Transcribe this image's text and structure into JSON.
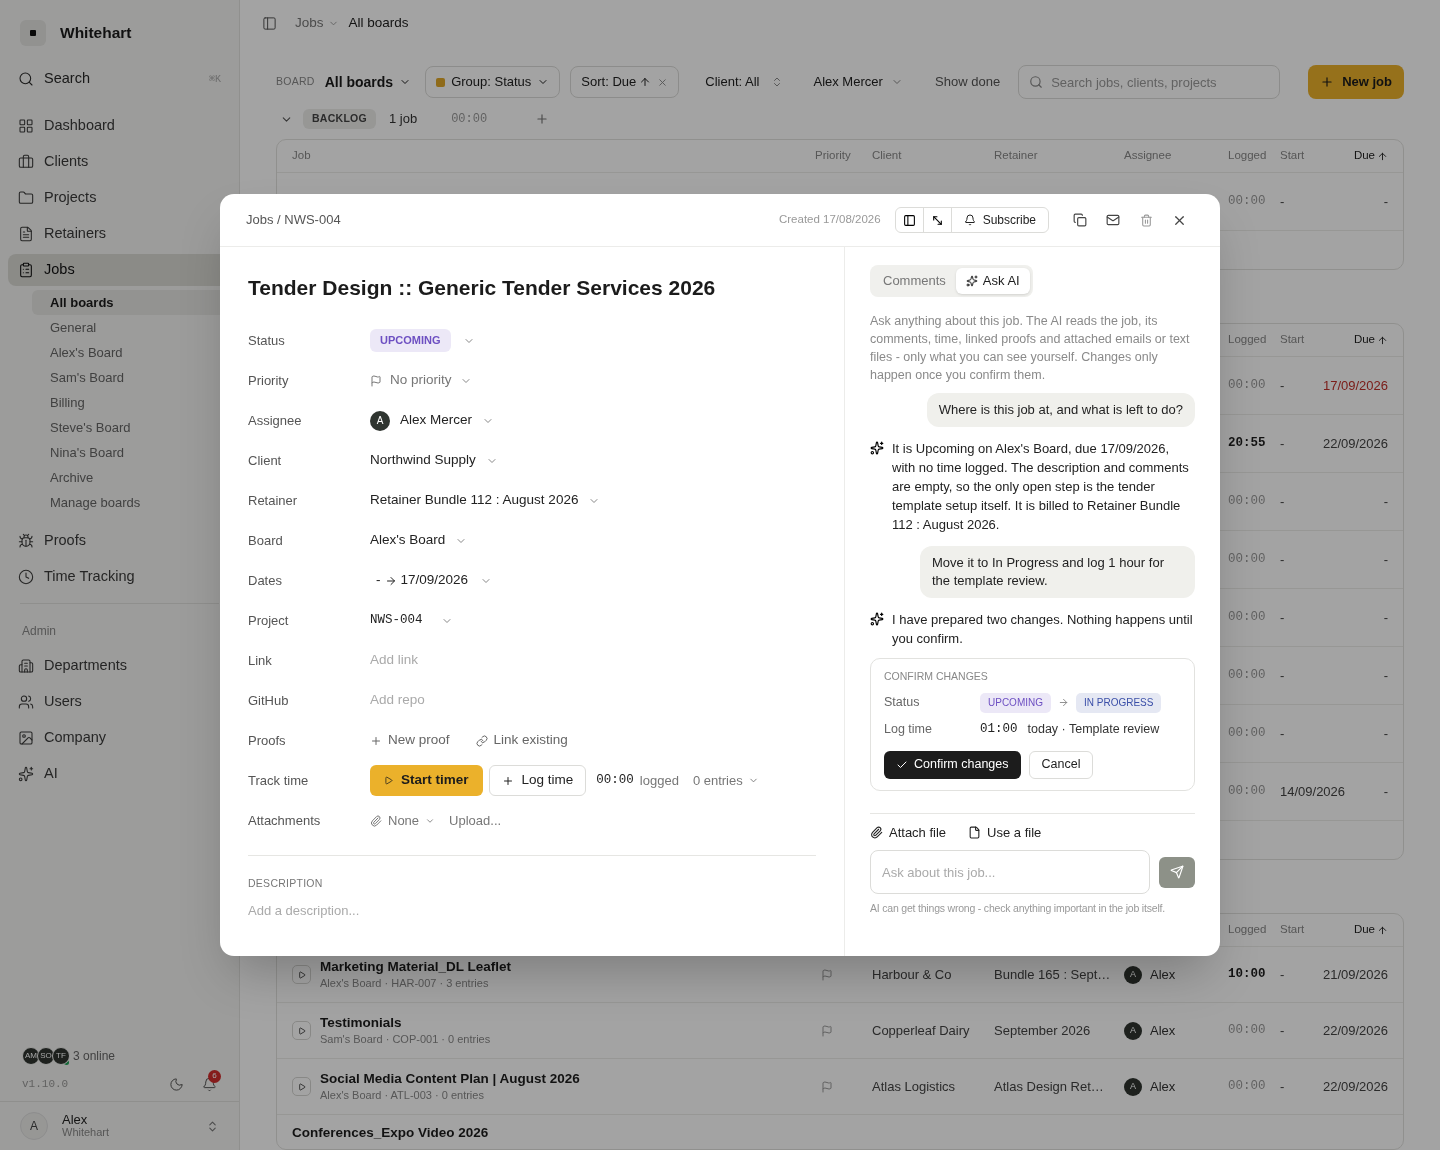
{
  "sidebar": {
    "brand": "Whitehart",
    "search": {
      "label": "Search",
      "shortcut": "⌘K"
    },
    "nav": [
      {
        "label": "Dashboard",
        "selected": false
      },
      {
        "label": "Clients",
        "selected": false
      },
      {
        "label": "Projects",
        "selected": false
      },
      {
        "label": "Retainers",
        "selected": false
      },
      {
        "label": "Jobs",
        "selected": true,
        "children": [
          {
            "label": "All boards",
            "selected": true
          },
          {
            "label": "General",
            "selected": false
          },
          {
            "label": "Alex's Board",
            "selected": false
          },
          {
            "label": "Sam's Board",
            "selected": false
          },
          {
            "label": "Billing",
            "selected": false
          },
          {
            "label": "Steve's Board",
            "selected": false
          },
          {
            "label": "Nina's Board",
            "selected": false
          },
          {
            "label": "Archive",
            "selected": false
          },
          {
            "label": "Manage boards",
            "selected": false
          }
        ]
      },
      {
        "label": "Proofs",
        "selected": false
      },
      {
        "label": "Time Tracking",
        "selected": false
      }
    ],
    "admin_label": "Admin",
    "admin_nav": [
      {
        "label": "Departments",
        "selected": false
      },
      {
        "label": "Users",
        "selected": false
      },
      {
        "label": "Company",
        "selected": false
      },
      {
        "label": "AI",
        "selected": false
      }
    ],
    "presence": {
      "avatars": [
        "AM",
        "SO",
        "TF"
      ],
      "label": "3 online"
    },
    "version": "v1.10.0",
    "notifications": "6",
    "user": {
      "initial": "A",
      "name": "Alex",
      "org": "Whitehart"
    }
  },
  "breadcrumb": [
    "Jobs",
    "All boards"
  ],
  "toolbar": {
    "board_label": "BOARD",
    "board": "All boards",
    "group": "Group: Status",
    "sort": "Sort: Due",
    "client": "Client: All",
    "person": "Alex Mercer",
    "show_done": "Show done",
    "search_placeholder": "Search jobs, clients, projects",
    "new_job": "New job"
  },
  "backlog": {
    "badge": "BACKLOG",
    "count": "1 job",
    "time": "00:00"
  },
  "board_tables": [
    {
      "columns": [
        {
          "kind": "job",
          "label": "Job",
          "sorted": false
        },
        {
          "kind": "priority",
          "label": "Priority",
          "sorted": false
        },
        {
          "kind": "client",
          "label": "Client",
          "sorted": false
        },
        {
          "kind": "retainer",
          "label": "Retainer",
          "sorted": false
        },
        {
          "kind": "assignee",
          "label": "Assignee",
          "sorted": false
        },
        {
          "kind": "logged",
          "label": "Logged",
          "sorted": false
        },
        {
          "kind": "start",
          "label": "Start",
          "sorted": false
        },
        {
          "kind": "due",
          "label": "Due",
          "sorted": true
        }
      ],
      "rows": [
        {
          "logged": "00:00",
          "has_time": false,
          "start": "-",
          "due": "-",
          "overdue": false
        }
      ]
    },
    {
      "columns": [
        {
          "kind": "logged",
          "label": "Logged",
          "sorted": false
        },
        {
          "kind": "start",
          "label": "Start",
          "sorted": false
        },
        {
          "kind": "due",
          "label": "Due",
          "sorted": true
        }
      ],
      "rows": [
        {
          "logged": "00:00",
          "has_time": false,
          "start": "-",
          "due": "17/09/2026",
          "overdue": true
        },
        {
          "logged": "20:55",
          "has_time": true,
          "start": "-",
          "due": "22/09/2026",
          "overdue": false
        },
        {
          "logged": "00:00",
          "has_time": false,
          "start": "-",
          "due": "-",
          "overdue": false
        },
        {
          "logged": "00:00",
          "has_time": false,
          "start": "-",
          "due": "-",
          "overdue": false
        },
        {
          "logged": "00:00",
          "has_time": false,
          "start": "-",
          "due": "-",
          "overdue": false
        },
        {
          "logged": "00:00",
          "has_time": false,
          "start": "-",
          "due": "-",
          "overdue": false
        },
        {
          "logged": "00:00",
          "has_time": false,
          "start": "-",
          "due": "-",
          "overdue": false
        },
        {
          "logged": "00:00",
          "has_time": false,
          "start": "14/09/2026",
          "due": "-",
          "overdue": false
        }
      ]
    },
    {
      "columns": [
        {
          "kind": "logged",
          "label": "Logged",
          "sorted": false
        },
        {
          "kind": "start",
          "label": "Start",
          "sorted": false
        },
        {
          "kind": "due",
          "label": "Due",
          "sorted": true
        }
      ],
      "rows": [
        {
          "title": "Marketing Material_DL Leaflet",
          "meta": "Alex's Board · HAR-007 · 3 entries",
          "client": "Harbour & Co",
          "retainer": "Bundle 165 : Sept…",
          "assignee": {
            "initial": "A",
            "name": "Alex"
          },
          "logged": "10:00",
          "has_time": true,
          "start": "-",
          "due": "21/09/2026",
          "overdue": false
        },
        {
          "title": "Testimonials",
          "meta": "Sam's Board · COP-001 · 0 entries",
          "client": "Copperleaf Dairy",
          "retainer": "September 2026",
          "assignee": {
            "initial": "A",
            "name": "Alex"
          },
          "logged": "00:00",
          "has_time": false,
          "start": "-",
          "due": "22/09/2026",
          "overdue": false
        },
        {
          "title": "Social Media Content Plan | August 2026",
          "meta": "Alex's Board · ATL-003 · 0 entries",
          "client": "Atlas Logistics",
          "retainer": "Atlas Design Ret…",
          "assignee": {
            "initial": "A",
            "name": "Alex"
          },
          "logged": "00:00",
          "has_time": false,
          "start": "-",
          "due": "22/09/2026",
          "overdue": false
        },
        {
          "title": "Conferences_Expo Video 2026"
        }
      ]
    }
  ],
  "modal": {
    "breadcrumb": "Jobs / NWS-004",
    "created": "Created 17/08/2026",
    "subscribe": "Subscribe",
    "title": "Tender Design :: Generic Tender Services 2026",
    "fields": [
      {
        "label": "Status",
        "kind": "badge",
        "value": "UPCOMING",
        "color": "#6d4fc2"
      },
      {
        "label": "Priority",
        "kind": "priority",
        "value": "No priority"
      },
      {
        "label": "Assignee",
        "kind": "person",
        "initial": "A",
        "value": "Alex Mercer"
      },
      {
        "label": "Client",
        "kind": "select",
        "value": "Northwind Supply"
      },
      {
        "label": "Retainer",
        "kind": "select",
        "value": "Retainer Bundle 112 : August 2026"
      },
      {
        "label": "Board",
        "kind": "select",
        "value": "Alex's Board"
      },
      {
        "label": "Dates",
        "kind": "dates",
        "start": "-",
        "end": "17/09/2026"
      },
      {
        "label": "Project",
        "kind": "code",
        "value": "NWS-004"
      },
      {
        "label": "Link",
        "kind": "empty",
        "placeholder": "Add link"
      },
      {
        "label": "GitHub",
        "kind": "empty",
        "placeholder": "Add repo"
      },
      {
        "label": "Proofs",
        "kind": "actions",
        "actions": [
          "New proof",
          "Link existing"
        ]
      },
      {
        "label": "Track time",
        "kind": "timer",
        "start": "Start timer",
        "log": "Log time",
        "time": "00:00",
        "time_label": "logged",
        "entries": "0 entries"
      },
      {
        "label": "Attachments",
        "kind": "attachments",
        "value": "None",
        "upload": "Upload..."
      }
    ],
    "description_label": "DESCRIPTION",
    "description_placeholder": "Add a description...",
    "tabs": [
      {
        "label": "Comments",
        "selected": false
      },
      {
        "label": "Ask AI",
        "selected": true
      }
    ],
    "intro": "Ask anything about this job. The AI reads the job, its comments, time, linked proofs and attached emails or text files - only what you can see yourself. Changes only happen once you confirm them.",
    "chat": [
      {
        "kind": "user",
        "text": "Where is this job at, and what is left to do?"
      },
      {
        "kind": "assistant",
        "text": "It is Upcoming on Alex's Board, due 17/09/2026, with no time logged. The description and comments are empty, so the only open step is the tender template setup itself. It is billed to Retainer Bundle 112 : August 2026."
      },
      {
        "kind": "user",
        "text": "Move it to In Progress and log 1 hour for the template review."
      },
      {
        "kind": "assistant",
        "text": "I have prepared two changes. Nothing happens until you confirm."
      }
    ],
    "confirm": {
      "title": "CONFIRM CHANGES",
      "status_label": "Status",
      "from": {
        "label": "UPCOMING",
        "color": "#6d4fc2"
      },
      "to": {
        "label": "IN PROGRESS",
        "color": "#3b4fa8"
      },
      "time_label": "Log time",
      "time": "01:00",
      "time_note": "today · Template review",
      "confirm": "Confirm changes",
      "cancel": "Cancel"
    },
    "attach": "Attach file",
    "use_file": "Use a file",
    "input_placeholder": "Ask about this job...",
    "footnote": "AI can get things wrong - check anything important in the job itself."
  }
}
